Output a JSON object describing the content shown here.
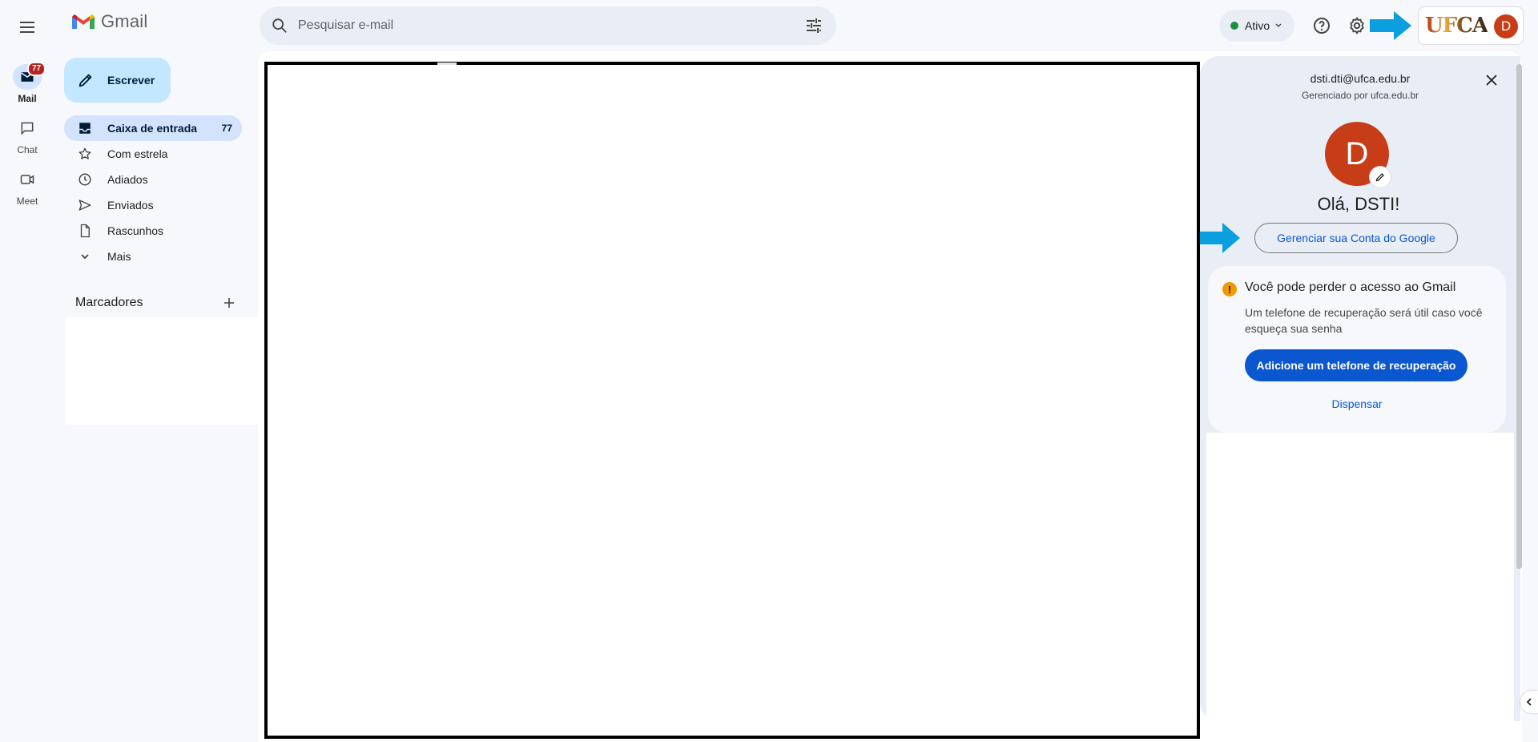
{
  "app": {
    "name": "Gmail"
  },
  "rail": {
    "items": [
      {
        "label": "Mail",
        "icon": "mail-icon",
        "badge": "77",
        "active": true
      },
      {
        "label": "Chat",
        "icon": "chat-icon"
      },
      {
        "label": "Meet",
        "icon": "meet-icon"
      }
    ]
  },
  "search": {
    "placeholder": "Pesquisar e-mail"
  },
  "status": {
    "label": "Ativo",
    "color": "#1e8e3e"
  },
  "account": {
    "org_logo": "UFCA",
    "avatar_letter": "D",
    "avatar_color": "#c63d17"
  },
  "compose": {
    "label": "Escrever"
  },
  "nav": {
    "items": [
      {
        "label": "Caixa de entrada",
        "icon": "inbox-icon",
        "count": "77",
        "active": true
      },
      {
        "label": "Com estrela",
        "icon": "star-icon"
      },
      {
        "label": "Adiados",
        "icon": "clock-icon"
      },
      {
        "label": "Enviados",
        "icon": "send-icon"
      },
      {
        "label": "Rascunhos",
        "icon": "draft-icon"
      },
      {
        "label": "Mais",
        "icon": "chevron-down-icon"
      }
    ]
  },
  "labels": {
    "title": "Marcadores"
  },
  "popup": {
    "email": "dsti.dti@ufca.edu.br",
    "managed_by": "Gerenciado por ufca.edu.br",
    "avatar_letter": "D",
    "greeting": "Olá, DSTI!",
    "manage_button": "Gerenciar sua Conta do Google",
    "warning": {
      "title": "Você pode perder o acesso ao Gmail",
      "text": "Um telefone de recuperação será útil caso você esqueça sua senha",
      "primary_button": "Adicione um telefone de recuperação",
      "dismiss": "Dispensar"
    }
  },
  "colors": {
    "accent": "#0b57d0",
    "compose_bg": "#c2e7ff",
    "active_nav": "#d3e3fd",
    "annotation_arrow": "#0aa0e0"
  }
}
